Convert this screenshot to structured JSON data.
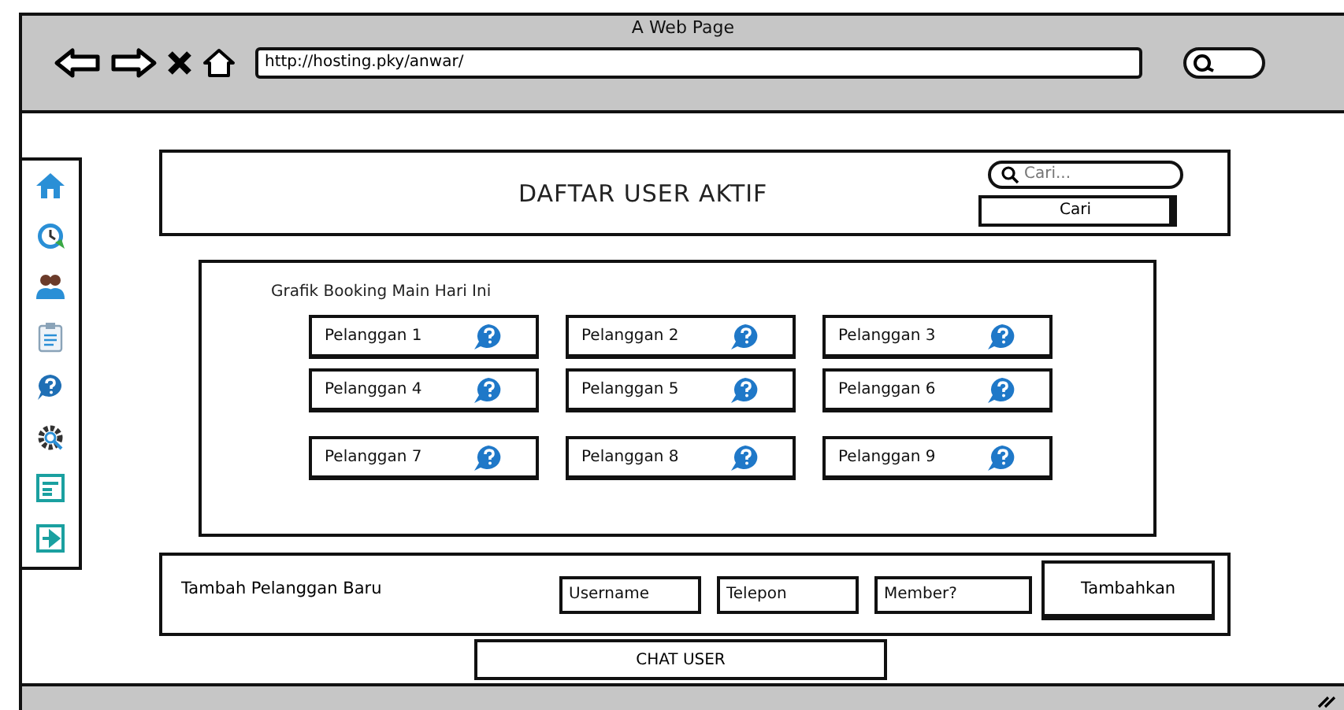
{
  "window": {
    "title": "A Web Page"
  },
  "address_bar": {
    "url": "http://hosting.pky/anwar/"
  },
  "sidebar": {
    "icons": [
      {
        "kind": "home"
      },
      {
        "kind": "clock"
      },
      {
        "kind": "users"
      },
      {
        "kind": "clipboard"
      },
      {
        "kind": "help"
      },
      {
        "kind": "gear"
      },
      {
        "kind": "form"
      },
      {
        "kind": "exit"
      }
    ]
  },
  "header": {
    "title": "DAFTAR USER AKTIF",
    "search": {
      "placeholder": "Cari..."
    },
    "search_button": "Cari"
  },
  "panel": {
    "title": "Grafik Booking Main Hari Ini",
    "customers": [
      {
        "label": "Pelanggan 1"
      },
      {
        "label": "Pelanggan 2"
      },
      {
        "label": "Pelanggan 3"
      },
      {
        "label": "Pelanggan 4"
      },
      {
        "label": "Pelanggan 5"
      },
      {
        "label": "Pelanggan 6"
      },
      {
        "label": "Pelanggan 7"
      },
      {
        "label": "Pelanggan 8"
      },
      {
        "label": "Pelanggan 9"
      }
    ]
  },
  "add_form": {
    "label": "Tambah Pelanggan Baru",
    "fields": [
      {
        "placeholder": "Username"
      },
      {
        "placeholder": "Telepon"
      },
      {
        "placeholder": "Member?"
      }
    ],
    "button": "Tambahkan"
  },
  "chat_button": "CHAT USER"
}
